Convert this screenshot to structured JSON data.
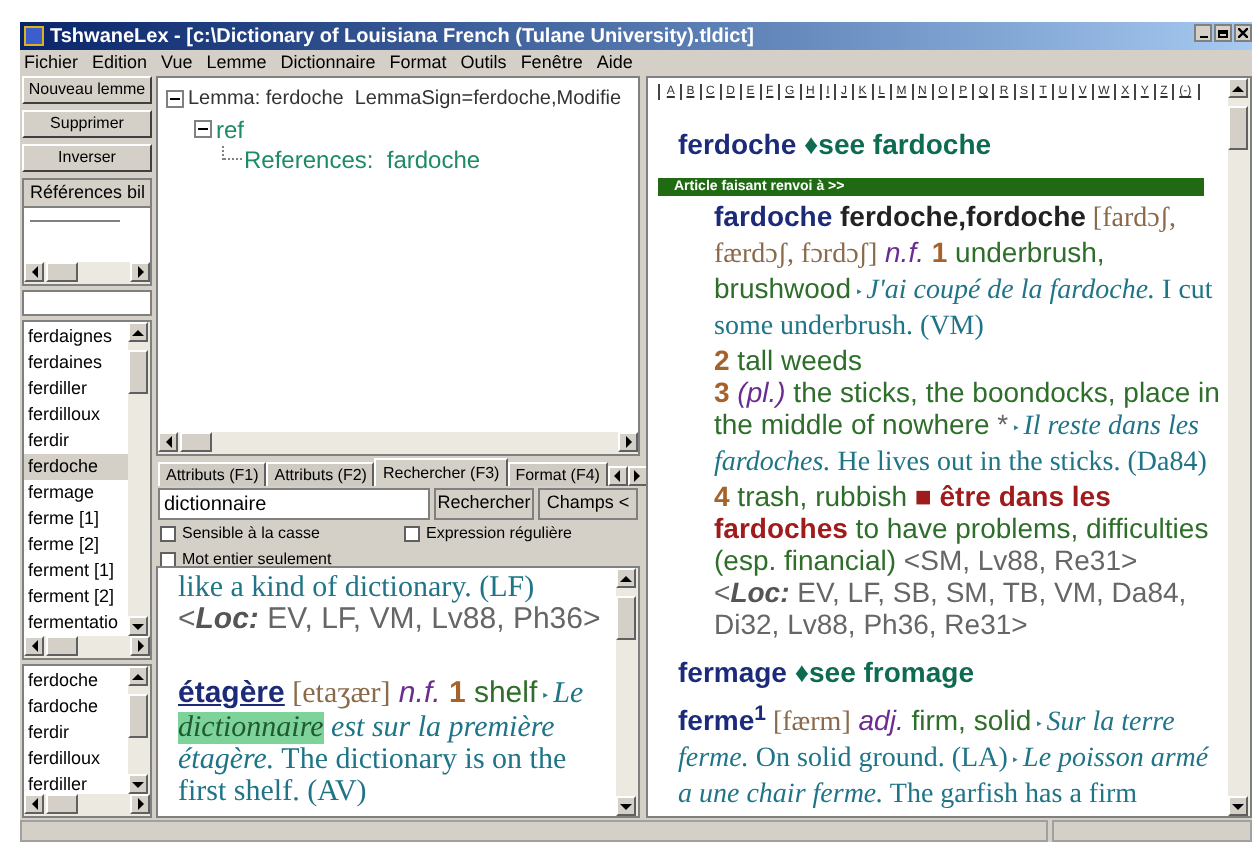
{
  "window": {
    "title": "TshwaneLex - [c:\\Dictionary of Louisiana French (Tulane University).tldict]"
  },
  "menu": [
    "Fichier",
    "Edition",
    "Vue",
    "Lemme",
    "Dictionnaire",
    "Format",
    "Outils",
    "Fenêtre",
    "Aide"
  ],
  "side_buttons": [
    "Nouveau lemme",
    "Supprimer",
    "Inverser"
  ],
  "references_panel": {
    "header": "Références bil"
  },
  "lemma_list": [
    {
      "label": "ferdaignes",
      "selected": false
    },
    {
      "label": "ferdaines",
      "selected": false
    },
    {
      "label": "ferdiller",
      "selected": false
    },
    {
      "label": "ferdilloux",
      "selected": false
    },
    {
      "label": "ferdir",
      "selected": false
    },
    {
      "label": "ferdoche",
      "selected": true
    },
    {
      "label": "fermage",
      "selected": false
    },
    {
      "label": "ferme [1]",
      "selected": false
    },
    {
      "label": "ferme [2]",
      "selected": false
    },
    {
      "label": "ferment [1]",
      "selected": false
    },
    {
      "label": "ferment [2]",
      "selected": false
    },
    {
      "label": "fermentatio",
      "selected": false
    }
  ],
  "history_list": [
    {
      "label": "ferdoche",
      "selected": false
    },
    {
      "label": "fardoche",
      "selected": false
    },
    {
      "label": "ferdir",
      "selected": false
    },
    {
      "label": "ferdilloux",
      "selected": false
    },
    {
      "label": "ferdiller",
      "selected": false
    }
  ],
  "tree": [
    {
      "label": "Lemma: ferdoche  LemmaSign=ferdoche,Modifie",
      "kind": "root",
      "expanded": true,
      "children": [
        {
          "label": "ref",
          "kind": "field",
          "expanded": true,
          "children": [
            {
              "label": "References:  fardoche",
              "kind": "field"
            }
          ]
        }
      ]
    }
  ],
  "tabs": [
    {
      "label": "Attributs (F1)",
      "selected": false
    },
    {
      "label": "Attributs (F2)",
      "selected": false
    },
    {
      "label": "Rechercher (F3)",
      "selected": true
    },
    {
      "label": "Format (F4)",
      "selected": false
    }
  ],
  "search": {
    "value": "dictionnaire",
    "button": "Rechercher",
    "fields_button": "Champs <"
  },
  "options": [
    {
      "label": "Sensible à la casse",
      "checked": false
    },
    {
      "label": "Expression régulière",
      "checked": false
    },
    {
      "label": "Mot entier seulement",
      "checked": false
    }
  ],
  "preview": [
    {
      "kind": "sense",
      "segments": [
        {
          "kind": "tr",
          "text": "like a kind of dictionary. (LF)"
        }
      ]
    },
    {
      "kind": "sense",
      "segments": [
        {
          "kind": "ref",
          "text": "<"
        },
        {
          "kind": "loclabel",
          "text": "Loc:"
        },
        {
          "kind": "ref",
          "text": " EV, LF, VM, Lv88, Ph36>"
        }
      ]
    },
    {
      "kind": "entry",
      "segments": [
        {
          "kind": "hwu",
          "text": "étagère"
        },
        {
          "kind": "pron",
          "text": " [etaʒær]"
        },
        {
          "kind": "pos",
          "text": " n.f."
        },
        {
          "kind": "num",
          "text": " 1"
        },
        {
          "kind": "gloss",
          "text": " shelf"
        },
        {
          "kind": "arrow",
          "text": " ‣ "
        },
        {
          "kind": "ex",
          "text": "Le "
        },
        {
          "kind": "hl",
          "text": "dictionnaire"
        },
        {
          "kind": "ex",
          "text": " est sur la première étagère."
        },
        {
          "kind": "tr",
          "text": " The dictionary is on the first shelf. (AV)"
        }
      ]
    }
  ],
  "article": {
    "alphabet": [
      "A",
      "B",
      "C",
      "D",
      "E",
      "F",
      "G",
      "H",
      "I",
      "J",
      "K",
      "L",
      "M",
      "N",
      "O",
      "P",
      "Q",
      "R",
      "S",
      "T",
      "U",
      "V",
      "W",
      "X",
      "Y",
      "Z",
      "(-)"
    ],
    "blocks": [
      {
        "kind": "entry",
        "segments": [
          {
            "kind": "hw",
            "text": "ferdoche"
          },
          {
            "kind": "see",
            "text": " ♦see fardoche"
          }
        ]
      },
      {
        "kind": "banner",
        "text": "Article faisant renvoi à >>"
      },
      {
        "kind": "sense",
        "segments": [
          {
            "kind": "hw",
            "text": "fardoche"
          },
          {
            "kind": "xref",
            "text": " ferdoche,fordoche"
          },
          {
            "kind": "pron",
            "text": " [fardɔʃ, færdɔʃ, fɔrdɔʃ]"
          },
          {
            "kind": "pos",
            "text": " n.f."
          },
          {
            "kind": "num",
            "text": " 1"
          },
          {
            "kind": "gloss",
            "text": " underbrush, brushwood"
          },
          {
            "kind": "arrow",
            "text": " ‣ "
          },
          {
            "kind": "ex",
            "text": "J'ai coupé de la fardoche."
          },
          {
            "kind": "tr",
            "text": " I cut some underbrush. (VM)"
          }
        ]
      },
      {
        "kind": "sense",
        "segments": [
          {
            "kind": "num",
            "text": "2"
          },
          {
            "kind": "gloss",
            "text": " tall weeds"
          }
        ]
      },
      {
        "kind": "sense",
        "segments": [
          {
            "kind": "num",
            "text": "3"
          },
          {
            "kind": "pos",
            "text": " (pl.)"
          },
          {
            "kind": "gloss",
            "text": " the sticks, the boondocks, place in the middle of nowhere "
          },
          {
            "kind": "ref",
            "text": "*"
          },
          {
            "kind": "arrow",
            "text": " ‣ "
          },
          {
            "kind": "ex",
            "text": "Il reste dans les fardoches."
          },
          {
            "kind": "tr",
            "text": " He lives out in the sticks. (Da84)"
          }
        ]
      },
      {
        "kind": "sense",
        "segments": [
          {
            "kind": "num",
            "text": "4"
          },
          {
            "kind": "gloss",
            "text": " trash, rubbish "
          },
          {
            "kind": "phrase",
            "text": "■ être dans les fardoches"
          },
          {
            "kind": "gloss",
            "text": " to have problems, difficulties (esp. financial)"
          },
          {
            "kind": "ref",
            "text": " <SM, Lv88, Re31>"
          }
        ]
      },
      {
        "kind": "sense",
        "segments": [
          {
            "kind": "ref",
            "text": "<"
          },
          {
            "kind": "loclabel",
            "text": "Loc:"
          },
          {
            "kind": "ref",
            "text": " EV, LF, SB, SM, TB, VM, Da84, Di32, Lv88, Ph36, Re31>"
          }
        ]
      },
      {
        "kind": "entry",
        "segments": [
          {
            "kind": "hw",
            "text": "fermage"
          },
          {
            "kind": "see",
            "text": " ♦see fromage"
          }
        ]
      },
      {
        "kind": "entry",
        "segments": [
          {
            "kind": "hw",
            "text": "ferme$^{1}$"
          },
          {
            "kind": "pron",
            "text": " [færm]"
          },
          {
            "kind": "pos",
            "text": " adj."
          },
          {
            "kind": "gloss",
            "text": " firm, solid"
          },
          {
            "kind": "arrow",
            "text": " ‣ "
          },
          {
            "kind": "ex",
            "text": "Sur la terre ferme."
          },
          {
            "kind": "tr",
            "text": " On solid ground. (LA)"
          },
          {
            "kind": "arrow",
            "text": " ‣ "
          },
          {
            "kind": "ex",
            "text": "Le poisson armé a une chair ferme."
          },
          {
            "kind": "tr",
            "text": " The garfish has a firm"
          }
        ]
      }
    ]
  }
}
